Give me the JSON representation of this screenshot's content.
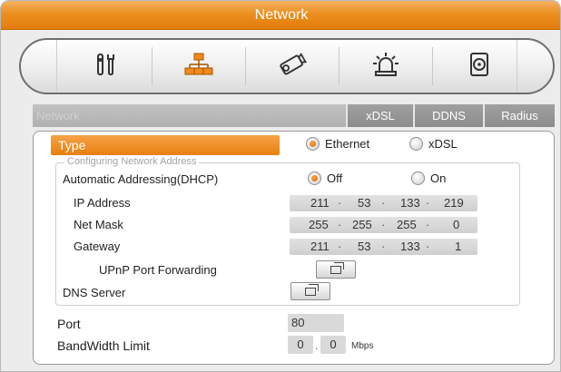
{
  "window": {
    "title": "Network"
  },
  "toolbar": {
    "icons": [
      {
        "name": "settings-tools-icon"
      },
      {
        "name": "network-icon"
      },
      {
        "name": "camera-icon"
      },
      {
        "name": "alarm-icon"
      },
      {
        "name": "storage-icon"
      }
    ]
  },
  "tabs": {
    "main": "Network",
    "xdsl": "xDSL",
    "ddns": "DDNS",
    "radius": "Radius"
  },
  "type": {
    "label": "Type",
    "options": {
      "ethernet": "Ethernet",
      "xdsl": "xDSL"
    },
    "selected": "Ethernet"
  },
  "config": {
    "legend": "Configuring Network Address",
    "dhcp": {
      "label": "Automatic Addressing(DHCP)",
      "off": "Off",
      "on": "On",
      "selected": "Off"
    },
    "ip": {
      "label": "IP Address",
      "octets": [
        "211",
        "53",
        "133",
        "219"
      ]
    },
    "mask": {
      "label": "Net Mask",
      "octets": [
        "255",
        "255",
        "255",
        "0"
      ]
    },
    "gateway": {
      "label": "Gateway",
      "octets": [
        "211",
        "53",
        "133",
        "1"
      ]
    },
    "upnp": {
      "label": "UPnP Port Forwarding"
    },
    "dns": {
      "label": "DNS Server"
    }
  },
  "port": {
    "label": "Port",
    "value": "80"
  },
  "bandwidth": {
    "label": "BandWidth Limit",
    "value_int": "0",
    "value_dec": "0",
    "unit": "Mbps"
  },
  "colors": {
    "accent": "#e8821a",
    "tab_bg": "#8f8f8f"
  }
}
